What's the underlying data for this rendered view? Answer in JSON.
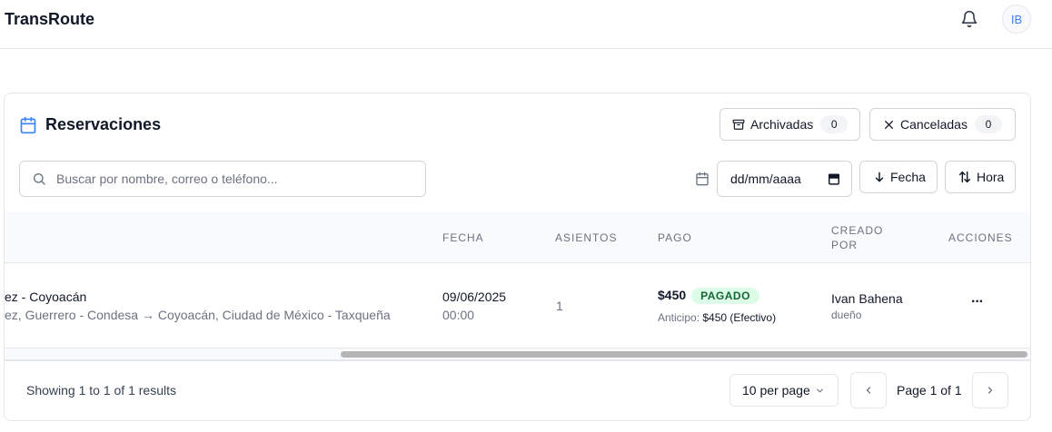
{
  "app": {
    "title": "TransRoute",
    "avatar_initials": "IB"
  },
  "card": {
    "title": "Reservaciones",
    "archived": {
      "label": "Archivadas",
      "count": "0"
    },
    "cancelled": {
      "label": "Canceladas",
      "count": "0"
    },
    "search": {
      "placeholder": "Buscar por nombre, correo o teléfono..."
    },
    "date_filter": {
      "value": "dd/mm/aaaa"
    },
    "sort_date": "Fecha",
    "sort_time": "Hora"
  },
  "table": {
    "headers": {
      "fecha": "FECHA",
      "asientos": "ASIENTOS",
      "pago": "PAGO",
      "creado_por_1": "CREADO",
      "creado_por_2": "POR",
      "acciones": "ACCIONES"
    },
    "rows": [
      {
        "route_title": "ez - Coyoacán",
        "route_detail": "ez, Guerrero - Condesa → Coyoacán, Ciudad de México - Taxqueña",
        "date": "09/06/2025",
        "time": "00:00",
        "seats": "1",
        "amount": "$450",
        "status": "PAGADO",
        "advance_label": "Anticipo:",
        "advance_value": "$450 (Efectivo)",
        "creator": "Ivan Bahena",
        "creator_role": "dueño",
        "actions": "···"
      }
    ]
  },
  "footer": {
    "results": "Showing 1 to 1 of 1 results",
    "per_page": "10 per page",
    "page": "Page 1 of 1"
  },
  "colors": {
    "accent": "#3b82f6",
    "paid_bg": "#dcfce7",
    "paid_text": "#166534"
  }
}
